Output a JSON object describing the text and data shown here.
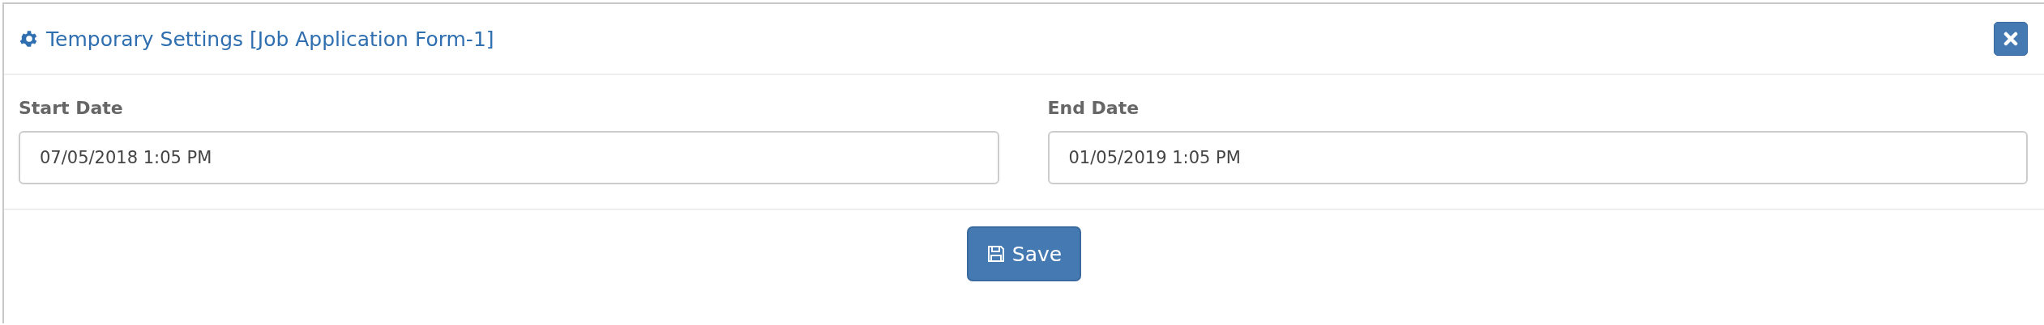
{
  "dialog": {
    "title": "Temporary Settings [Job Application Form-1]"
  },
  "fields": [
    {
      "label": "Start Date",
      "value": "07/05/2018 1:05 PM"
    },
    {
      "label": "End Date",
      "value": "01/05/2019 1:05 PM"
    }
  ],
  "buttons": [
    {
      "label": "Save"
    }
  ]
}
